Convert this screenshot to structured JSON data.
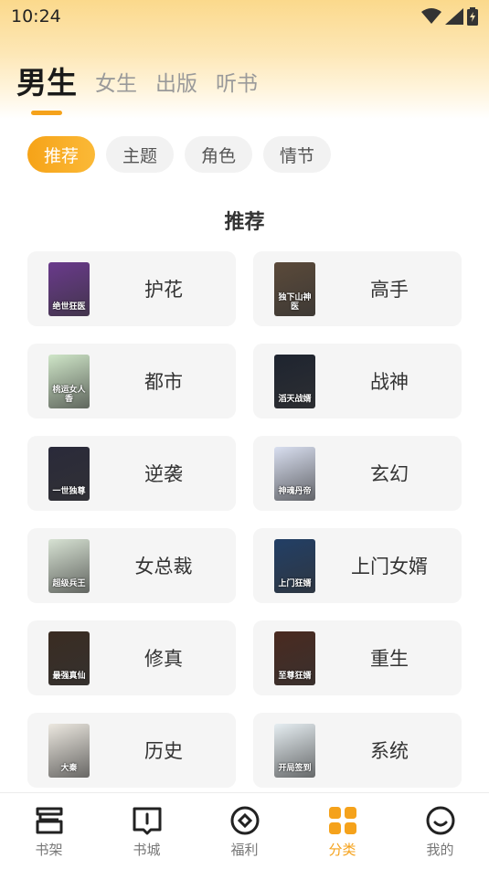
{
  "status_bar": {
    "time": "10:24"
  },
  "top_tabs": [
    {
      "label": "男生",
      "active": true
    },
    {
      "label": "女生",
      "active": false
    },
    {
      "label": "出版",
      "active": false
    },
    {
      "label": "听书",
      "active": false
    }
  ],
  "chips": [
    {
      "label": "推荐",
      "active": true
    },
    {
      "label": "主题",
      "active": false
    },
    {
      "label": "角色",
      "active": false
    },
    {
      "label": "情节",
      "active": false
    }
  ],
  "section_title": "推荐",
  "categories": [
    {
      "label": "护花",
      "cover_text": "绝世狂医",
      "cover_color": "#6a3a8c"
    },
    {
      "label": "高手",
      "cover_text": "独下山神医",
      "cover_color": "#5b4a3a"
    },
    {
      "label": "都市",
      "cover_text": "桃运女人香",
      "cover_color": "#cfe6c8"
    },
    {
      "label": "战神",
      "cover_text": "滔天战婿",
      "cover_color": "#1e2430"
    },
    {
      "label": "逆袭",
      "cover_text": "一世独尊",
      "cover_color": "#2a2a3a"
    },
    {
      "label": "玄幻",
      "cover_text": "神魂丹帝",
      "cover_color": "#d9dff0"
    },
    {
      "label": "女总裁",
      "cover_text": "超级兵王",
      "cover_color": "#d7e2d3"
    },
    {
      "label": "上门女婿",
      "cover_text": "上门狂婿",
      "cover_color": "#223f66"
    },
    {
      "label": "修真",
      "cover_text": "最强真仙",
      "cover_color": "#3a2c22"
    },
    {
      "label": "重生",
      "cover_text": "至尊狂婿",
      "cover_color": "#4a2a20"
    },
    {
      "label": "历史",
      "cover_text": "大秦",
      "cover_color": "#ece8e0"
    },
    {
      "label": "系统",
      "cover_text": "开局签到",
      "cover_color": "#e6eef2"
    }
  ],
  "bottom_nav": [
    {
      "label": "书架",
      "icon": "bookshelf-icon",
      "active": false
    },
    {
      "label": "书城",
      "icon": "book-store-icon",
      "active": false
    },
    {
      "label": "福利",
      "icon": "welfare-icon",
      "active": false
    },
    {
      "label": "分类",
      "icon": "category-icon",
      "active": true
    },
    {
      "label": "我的",
      "icon": "profile-icon",
      "active": false
    }
  ],
  "colors": {
    "accent": "#f5a21b",
    "card_bg": "#f5f5f5",
    "chip_bg": "#f2f2f2"
  }
}
